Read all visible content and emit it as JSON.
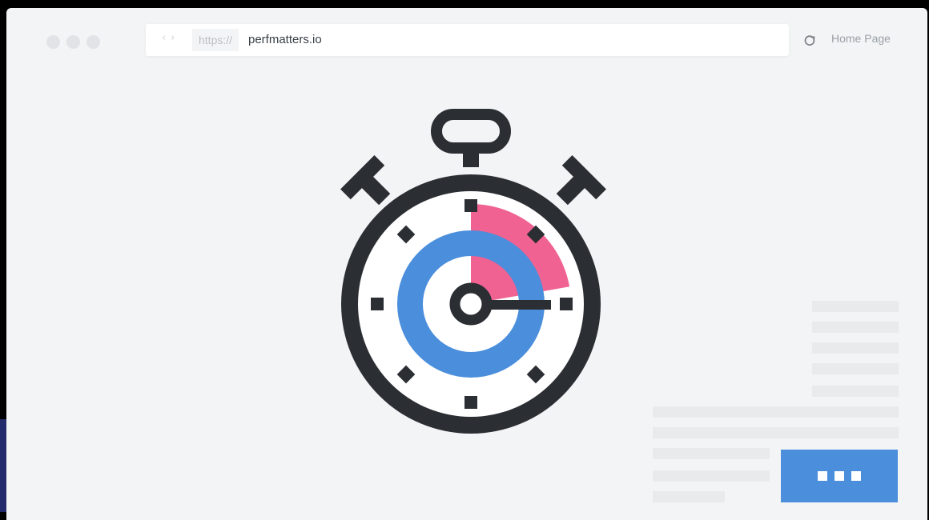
{
  "browser": {
    "url_scheme": "https://",
    "url_domain": "perfmatters.io",
    "home_label": "Home Page",
    "nav_back_icon": "chevron-left-icon",
    "nav_forward_icon": "chevron-right-icon",
    "reload_icon": "reload-icon"
  },
  "illustration": {
    "icon": "stopwatch-icon"
  },
  "colors": {
    "accent_blue": "#4a8edc",
    "accent_pink": "#f06292",
    "outline": "#2b2e33",
    "page_background": "#f3f4f5"
  }
}
